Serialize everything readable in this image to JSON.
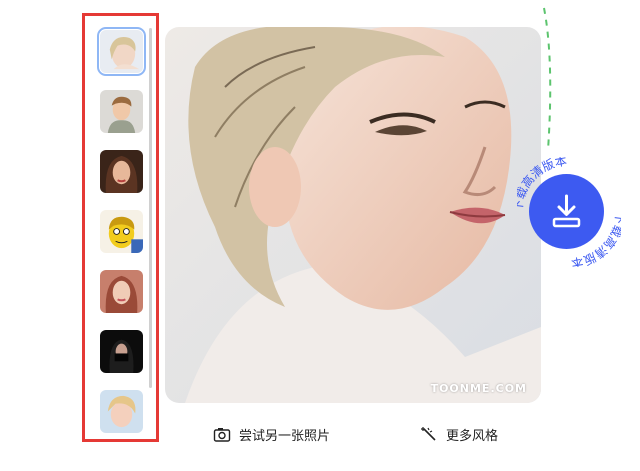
{
  "styles_panel": {
    "thumbnails": [
      {
        "name": "blonde-sketch-style",
        "selected": true
      },
      {
        "name": "3d-boy-style",
        "selected": false
      },
      {
        "name": "brunette-portrait-style",
        "selected": false
      },
      {
        "name": "yellow-cartoon-style",
        "selected": false
      },
      {
        "name": "redhead-portrait-style",
        "selected": false
      },
      {
        "name": "dark-hooded-style",
        "selected": false
      },
      {
        "name": "3d-blonde-style",
        "selected": false
      }
    ]
  },
  "result": {
    "watermark": "TOONME.COM"
  },
  "download": {
    "label": "下载高清版本"
  },
  "actions": {
    "retry_label": "尝试另一张照片",
    "more_styles_label": "更多风格"
  },
  "colors": {
    "accent": "#3d5af1",
    "highlight_frame": "#e53935",
    "selected_outline": "#8fb7f5"
  }
}
